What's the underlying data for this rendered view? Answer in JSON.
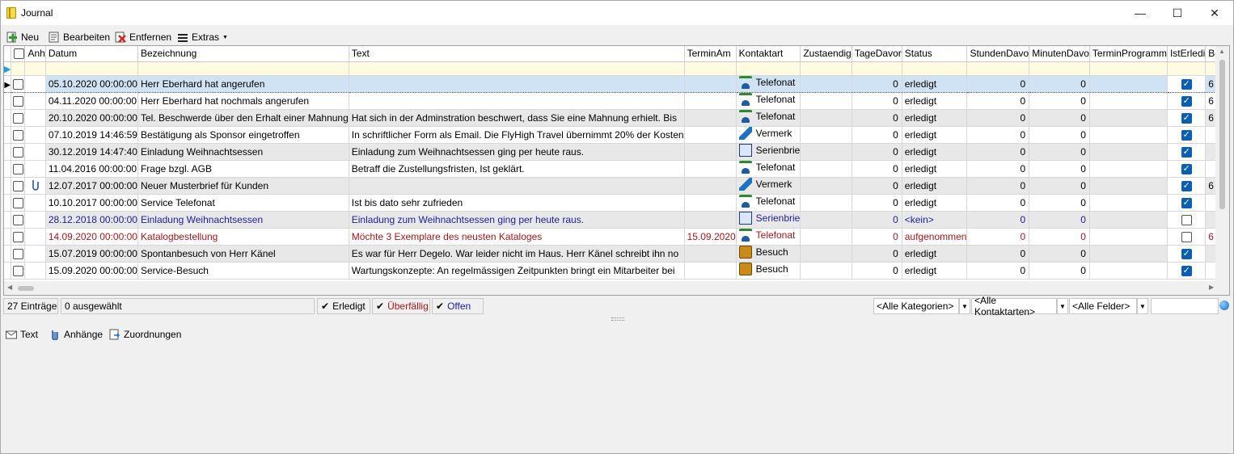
{
  "window": {
    "title": "Journal"
  },
  "toolbar": {
    "new": "Neu",
    "edit": "Bearbeiten",
    "delete": "Entfernen",
    "extras": "Extras"
  },
  "columns": [
    "Anh",
    "Datum",
    "Bezeichnung",
    "Text",
    "TerminAm",
    "Kontaktart",
    "Zustaendig",
    "TageDavor",
    "Status",
    "StundenDavo",
    "MinutenDavo",
    "TerminProgramm",
    "IstErledi",
    "Bearbeitet v"
  ],
  "rows": [
    {
      "style": "sel",
      "attach": false,
      "date": "05.10.2020 00:00:00",
      "title": "Herr Eberhard hat angerufen",
      "text": "",
      "termin": "",
      "kontakt": "Telefonat",
      "kicon": "phone-icon",
      "zust": "",
      "tage": "0",
      "status": "erledigt",
      "std": "0",
      "min": "0",
      "prog": "",
      "done": true,
      "bearb": "6"
    },
    {
      "style": "even",
      "attach": false,
      "date": "04.11.2020 00:00:00",
      "title": "Herr Eberhard hat nochmals angerufen",
      "text": "",
      "termin": "",
      "kontakt": "Telefonat",
      "kicon": "phone-icon",
      "zust": "",
      "tage": "0",
      "status": "erledigt",
      "std": "0",
      "min": "0",
      "prog": "",
      "done": true,
      "bearb": "6"
    },
    {
      "style": "odd",
      "attach": false,
      "date": "20.10.2020 00:00:00",
      "title": "Tel. Beschwerde über den Erhalt einer Mahnung",
      "text": "Hat sich in der Adminstration beschwert, dass Sie eine Mahnung erhielt. Bis",
      "termin": "",
      "kontakt": "Telefonat",
      "kicon": "phone-icon",
      "zust": "",
      "tage": "0",
      "status": "erledigt",
      "std": "0",
      "min": "0",
      "prog": "",
      "done": true,
      "bearb": "6"
    },
    {
      "style": "even",
      "attach": false,
      "date": "07.10.2019 14:46:59",
      "title": "Bestätigung als Sponsor eingetroffen",
      "text": "In schriftlicher Form als Email. Die FlyHigh Travel übernimmt 20% der Kosten",
      "termin": "",
      "kontakt": "Vermerk",
      "kicon": "note-pin-icon",
      "zust": "",
      "tage": "0",
      "status": "erledigt",
      "std": "0",
      "min": "0",
      "prog": "",
      "done": true,
      "bearb": ""
    },
    {
      "style": "odd",
      "attach": false,
      "date": "30.12.2019 14:47:40",
      "title": "Einladung Weihnachtsessen",
      "text": "Einladung zum Weihnachtsessen ging per heute raus.",
      "termin": "",
      "kontakt": "Serienbrie",
      "kicon": "serial-letter-icon",
      "zust": "",
      "tage": "0",
      "status": "erledigt",
      "std": "0",
      "min": "0",
      "prog": "",
      "done": true,
      "bearb": ""
    },
    {
      "style": "even",
      "attach": false,
      "date": "11.04.2016 00:00:00",
      "title": "Frage bzgl. AGB",
      "text": "Betraff die Zustellungsfristen, Ist geklärt.",
      "termin": "",
      "kontakt": "Telefonat",
      "kicon": "phone-icon",
      "zust": "",
      "tage": "0",
      "status": "erledigt",
      "std": "0",
      "min": "0",
      "prog": "",
      "done": true,
      "bearb": ""
    },
    {
      "style": "odd",
      "attach": true,
      "date": "12.07.2017 00:00:00",
      "title": "Neuer Musterbrief für Kunden",
      "text": "",
      "termin": "",
      "kontakt": "Vermerk",
      "kicon": "note-pin-icon",
      "zust": "",
      "tage": "0",
      "status": "erledigt",
      "std": "0",
      "min": "0",
      "prog": "",
      "done": true,
      "bearb": "6"
    },
    {
      "style": "even",
      "attach": false,
      "date": "10.10.2017 00:00:00",
      "title": "Service Telefonat",
      "text": "Ist bis dato sehr zufrieden",
      "termin": "",
      "kontakt": "Telefonat",
      "kicon": "phone-out-icon",
      "zust": "",
      "tage": "0",
      "status": "erledigt",
      "std": "0",
      "min": "0",
      "prog": "",
      "done": true,
      "bearb": ""
    },
    {
      "style": "odd blue",
      "attach": false,
      "date": "28.12.2018 00:00:00",
      "title": "Einladung Weihnachtsessen",
      "text": "Einladung zum Weihnachtsessen ging per heute raus.",
      "termin": "",
      "kontakt": "Serienbrie",
      "kicon": "serial-letter-icon",
      "zust": "",
      "tage": "0",
      "status": "<kein>",
      "std": "0",
      "min": "0",
      "prog": "",
      "done": false,
      "bearb": ""
    },
    {
      "style": "even red",
      "attach": false,
      "date": "14.09.2020 00:00:00",
      "title": "Katalogbestellung",
      "text": "Möchte 3 Exemplare des neusten Kataloges",
      "termin": "15.09.2020",
      "kontakt": "Telefonat",
      "kicon": "phone-icon",
      "zust": "",
      "tage": "0",
      "status": "aufgenommen",
      "std": "0",
      "min": "0",
      "prog": "",
      "done": false,
      "bearb": "6"
    },
    {
      "style": "odd",
      "attach": false,
      "date": "15.07.2019 00:00:00",
      "title": "Spontanbesuch von Herr Känel",
      "text": "Es war für Herr Degelo. War leider nicht im Haus. Herr Känel schreibt ihn no",
      "termin": "",
      "kontakt": "Besuch",
      "kicon": "visit-icon",
      "zust": "",
      "tage": "0",
      "status": "erledigt",
      "std": "0",
      "min": "0",
      "prog": "",
      "done": true,
      "bearb": ""
    },
    {
      "style": "even",
      "attach": false,
      "date": "15.09.2020 00:00:00",
      "title": "Service-Besuch",
      "text": "Wartungskonzepte: An regelmässigen Zeitpunkten bringt ein Mitarbeiter bei",
      "termin": "",
      "kontakt": "Besuch",
      "kicon": "visit-icon",
      "zust": "",
      "tage": "0",
      "status": "erledigt",
      "std": "0",
      "min": "0",
      "prog": "",
      "done": true,
      "bearb": ""
    }
  ],
  "status": {
    "count": "27 Einträge",
    "selected": "0 ausgewählt",
    "filter_done": "Erledigt",
    "filter_overdue": "Überfällig",
    "filter_open": "Offen",
    "categories": "<Alle Kategorien>",
    "contact_types": "<Alle Kontaktarten>",
    "fields": "<Alle Felder>"
  },
  "bottom": {
    "text": "Text",
    "attachments": "Anhänge",
    "assignments": "Zuordnungen"
  },
  "colors": {
    "selected_row": "#cfe3f5",
    "alt_row": "#e8e8e8",
    "blue_text": "#1d1aa8",
    "red_text": "#b0151b",
    "check": "#0a5fb4"
  }
}
